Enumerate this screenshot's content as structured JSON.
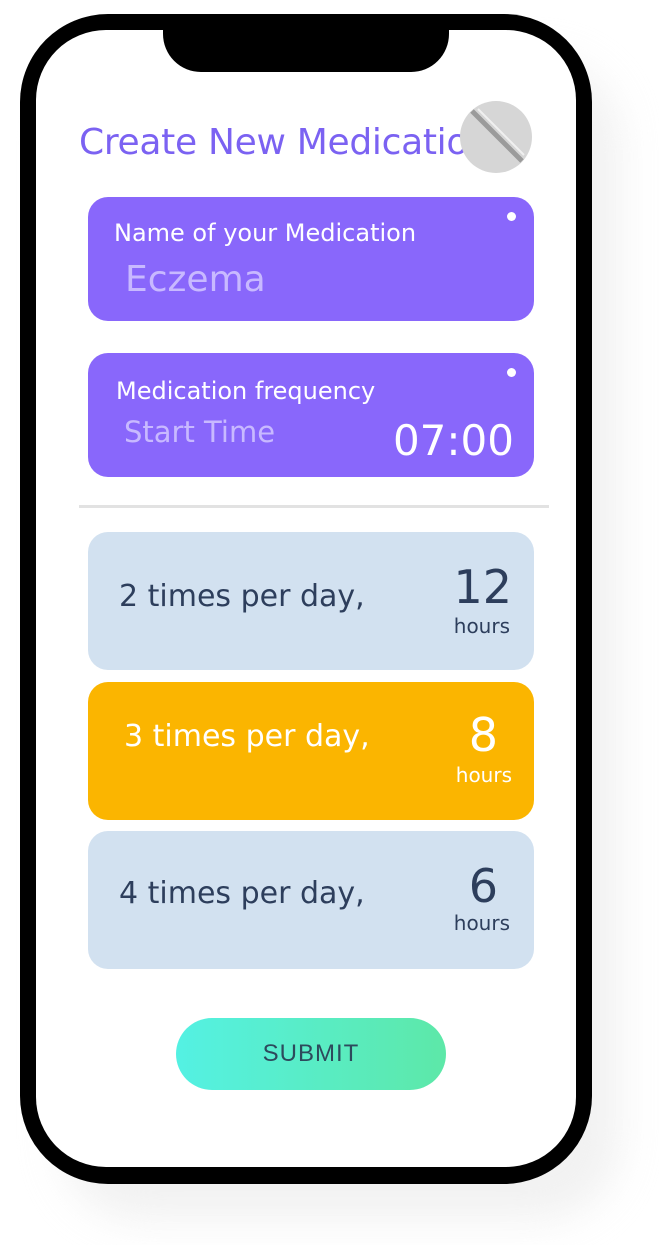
{
  "header": {
    "title": "Create New Medication",
    "icon": "pill-icon"
  },
  "medication_name": {
    "label": "Name of your Medication",
    "value": "Eczema"
  },
  "frequency": {
    "label": "Medication frequency",
    "placeholder": "Start Time",
    "time": "07:00"
  },
  "options": [
    {
      "text": "2 times per day,",
      "interval": "12",
      "unit": "hours",
      "selected": false
    },
    {
      "text": "3 times per day,",
      "interval": "8",
      "unit": "hours",
      "selected": true
    },
    {
      "text": "4 times per day,",
      "interval": "6",
      "unit": "hours",
      "selected": false
    }
  ],
  "submit_label": "SUBMIT",
  "colors": {
    "accent": "#8967fb",
    "title": "#7b62f2",
    "selected": "#fbb500",
    "option": "#d2e1f0"
  }
}
